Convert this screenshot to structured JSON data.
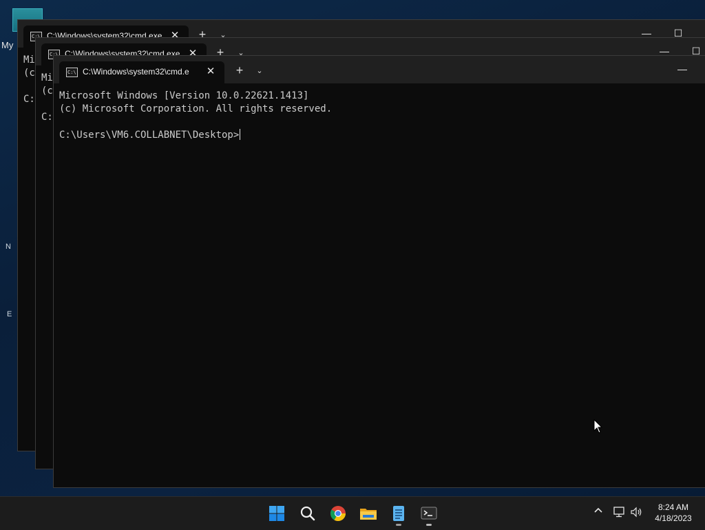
{
  "desktop": {
    "icon_label": "My",
    "edge_letters": [
      "N",
      "E"
    ]
  },
  "windows": [
    {
      "tab_title": "C:\\Windows\\system32\\cmd.exe",
      "console_lines": [
        "Mi",
        "(c",
        "",
        "C:"
      ]
    },
    {
      "tab_title": "C:\\Windows\\system32\\cmd.exe",
      "console_lines": [
        "Mi",
        "(c",
        "",
        "C:"
      ]
    },
    {
      "tab_title": "C:\\Windows\\system32\\cmd.e",
      "tab_close": "✕",
      "new_tab": "+",
      "dropdown": "⌄",
      "minimize": "—",
      "console_lines": [
        "Microsoft Windows [Version 10.0.22621.1413]",
        "(c) Microsoft Corporation. All rights reserved.",
        "",
        "C:\\Users\\VM6.COLLABNET\\Desktop>"
      ]
    }
  ],
  "taskbar": {
    "apps": [
      "start-icon",
      "search-icon",
      "chrome-icon",
      "file-explorer-icon",
      "notepad-icon",
      "terminal-icon"
    ],
    "tray_chevron": "^",
    "clock": {
      "time": "8:24 AM",
      "date": "4/18/2023"
    }
  },
  "colors": {
    "console_bg": "#0c0c0c",
    "titlebar_bg": "#202020",
    "text": "#cccccc"
  }
}
